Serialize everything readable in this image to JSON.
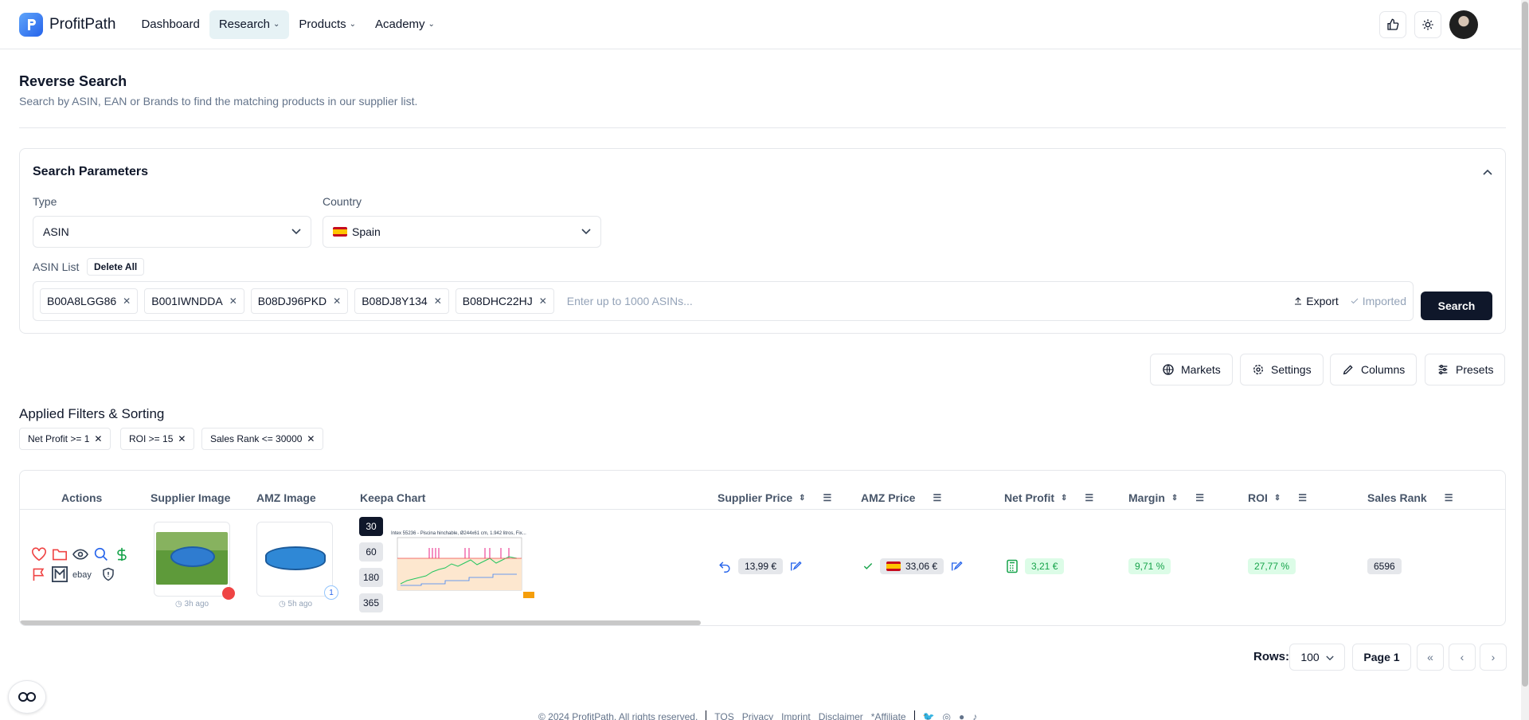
{
  "app": {
    "name": "ProfitPath",
    "nav": [
      "Dashboard",
      "Research",
      "Products",
      "Academy"
    ]
  },
  "page": {
    "title": "Reverse Search",
    "subtitle": "Search by ASIN, EAN or Brands to find the matching products in our supplier list."
  },
  "search_params": {
    "title": "Search Parameters",
    "type_label": "Type",
    "type_value": "ASIN",
    "country_label": "Country",
    "country_value": "Spain",
    "asin_list_label": "ASIN List",
    "delete_all_label": "Delete All",
    "asins": [
      "B00A8LGG86",
      "B001IWNDDA",
      "B08DJ96PKD",
      "B08DJ8Y134",
      "B08DHC22HJ"
    ],
    "asin_placeholder": "Enter up to 1000 ASINs...",
    "export_label": "Export",
    "imported_label": "Imported",
    "search_label": "Search"
  },
  "toolbar": {
    "markets": "Markets",
    "settings": "Settings",
    "columns": "Columns",
    "presets": "Presets"
  },
  "filters": {
    "title": "Applied Filters & Sorting",
    "chips": [
      "Net Profit >= 1",
      "ROI >= 15",
      "Sales Rank <= 30000"
    ]
  },
  "table": {
    "columns": [
      "Actions",
      "Supplier Image",
      "AMZ Image",
      "Keepa Chart",
      "Supplier Price",
      "AMZ Price",
      "Net Profit",
      "Margin",
      "ROI",
      "Sales Rank"
    ],
    "row": {
      "supplier_ago": "3h ago",
      "amz_ago": "5h ago",
      "amz_badge": "1",
      "ranges": [
        "30",
        "60",
        "180",
        "365"
      ],
      "keepa_title": "Intex 55236 - Piscina hinchable, Ø244x61 cm, 1.942 litros, Fix...",
      "supplier_price": "13,99 €",
      "amz_price": "33,06 €",
      "net_profit": "3,21 €",
      "margin": "9,71 %",
      "roi": "27,77 %",
      "sales_rank": "6596"
    }
  },
  "pagination": {
    "rows_label": "Rows:",
    "rows_value": "100",
    "page_label": "Page 1"
  },
  "footer": {
    "copyright": "© 2024 ProfitPath. All rights reserved.",
    "links": [
      "TOS",
      "Privacy",
      "Imprint",
      "Disclaimer",
      "*Affiliate"
    ]
  },
  "colors": {
    "primary": "#0f172a",
    "accent_nav": "#e6f2f5",
    "green": "#16a34a",
    "green_bg": "#dcfce7",
    "red": "#ef4444",
    "blue": "#2563eb"
  }
}
